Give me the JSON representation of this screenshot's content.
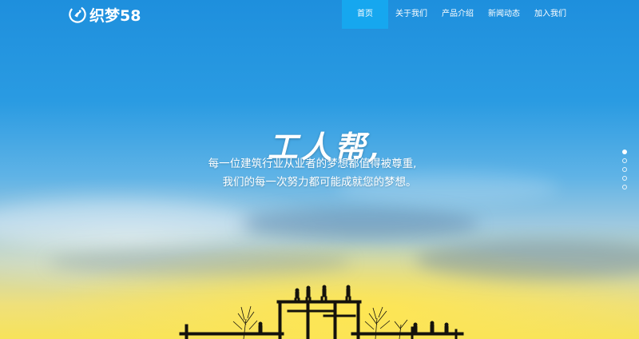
{
  "brand": {
    "name": "织梦58"
  },
  "nav": {
    "items": [
      {
        "label": "首页",
        "active": true
      },
      {
        "label": "关于我们",
        "active": false
      },
      {
        "label": "产品介绍",
        "active": false
      },
      {
        "label": "新闻动态",
        "active": false
      },
      {
        "label": "加入我们",
        "active": false
      }
    ]
  },
  "banner": {
    "slogan": "工人帮,",
    "line1": "每一位建筑行业从业者的梦想都值得被尊重,",
    "line2": "我们的每一次努力都可能成就您的梦想。"
  },
  "slider": {
    "count": 5,
    "active_index": 0
  },
  "colors": {
    "nav_active": "#16a7ef",
    "sky_top": "#1e8fdd",
    "horizon": "#f7e35a",
    "silhouette": "#14120c"
  }
}
